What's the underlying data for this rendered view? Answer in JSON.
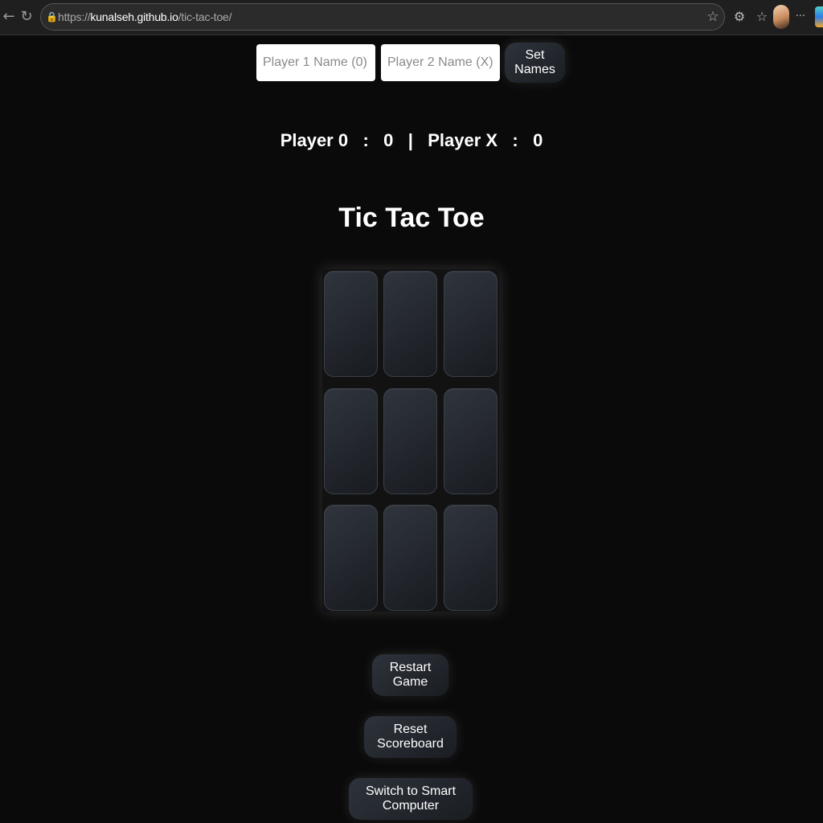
{
  "browser": {
    "url_prefix": "https://",
    "url_host": "kunalseh.github.io",
    "url_path": "/tic-tac-toe/",
    "back_icon": "back-arrow-icon",
    "reload_icon": "reload-icon",
    "lock_icon": "lock-icon",
    "star_icon": "star-icon",
    "more_label": "···"
  },
  "names": {
    "player1_placeholder": "Player 1 Name (0)",
    "player2_placeholder": "Player 2 Name (X)",
    "set_button": "Set Names"
  },
  "scoreboard": {
    "player1_label": "Player 0",
    "sep1": ":",
    "player1_score": "0",
    "divider": "|",
    "player2_label": "Player X",
    "sep2": ":",
    "player2_score": "0"
  },
  "title": "Tic Tac Toe",
  "board": {
    "cells": [
      "",
      "",
      "",
      "",
      "",
      "",
      "",
      "",
      ""
    ]
  },
  "buttons": {
    "restart": "Restart Game",
    "reset": "Reset Scoreboard",
    "smart": "Switch to Smart Computer"
  }
}
